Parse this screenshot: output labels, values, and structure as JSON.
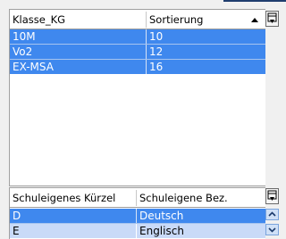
{
  "grid_klassen": {
    "columns": [
      "Klasse_KG",
      "Sortierung"
    ],
    "rows": [
      [
        "10M",
        "10"
      ],
      [
        "Vo2",
        "12"
      ],
      [
        "EX-MSA",
        "16"
      ]
    ],
    "sort_icon": "sort-ascending-icon",
    "column_chooser_icon": "column-chooser-icon"
  },
  "grid_schulbez": {
    "columns": [
      "Schuleigenes Kürzel",
      "Schuleigene Bez."
    ],
    "rows": [
      [
        "D",
        "Deutsch"
      ],
      [
        "E",
        "Englisch"
      ]
    ],
    "column_chooser_icon": "column-chooser-icon",
    "scroll_up_icon": "scroll-up-icon",
    "scroll_down_icon": "scroll-down-icon"
  },
  "colors": {
    "selection": "#3f88ee",
    "selection_light": "#c9daf8",
    "header_bg": "#ffffff"
  }
}
